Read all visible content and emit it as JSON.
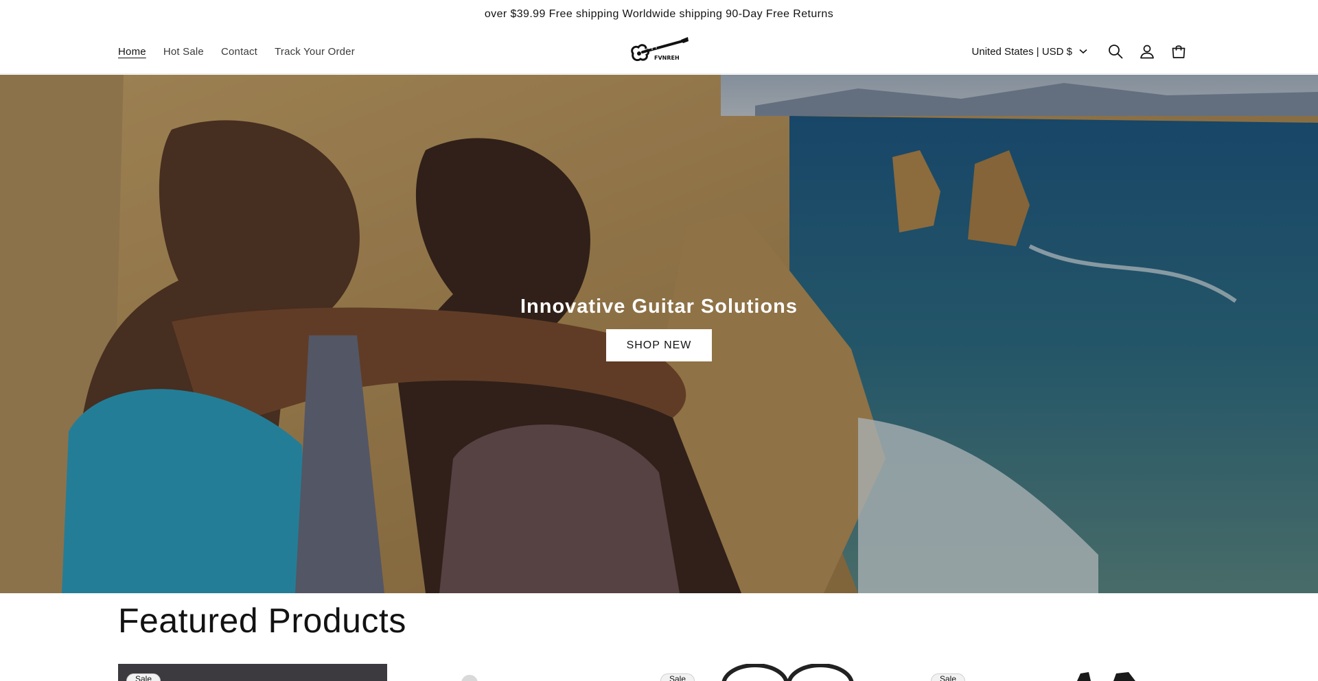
{
  "announcement": {
    "text": "over $39.99 Free shipping Worldwide shipping 90-Day Free Returns"
  },
  "header": {
    "nav": [
      {
        "label": "Home",
        "active": true
      },
      {
        "label": "Hot Sale",
        "active": false
      },
      {
        "label": "Contact",
        "active": false
      },
      {
        "label": "Track Your Order",
        "active": false
      }
    ],
    "logo_text": "FVNREH",
    "country_selector": "United States | USD $",
    "icons": [
      "search-icon",
      "account-icon",
      "cart-icon"
    ]
  },
  "hero": {
    "title": "Innovative Guitar Solutions",
    "button_label": "SHOP NEW"
  },
  "featured": {
    "title": "Featured Products",
    "badge_label": "Sale"
  },
  "colors": {
    "text": "#121212",
    "background": "#ffffff",
    "button_bg": "#ffffff"
  }
}
